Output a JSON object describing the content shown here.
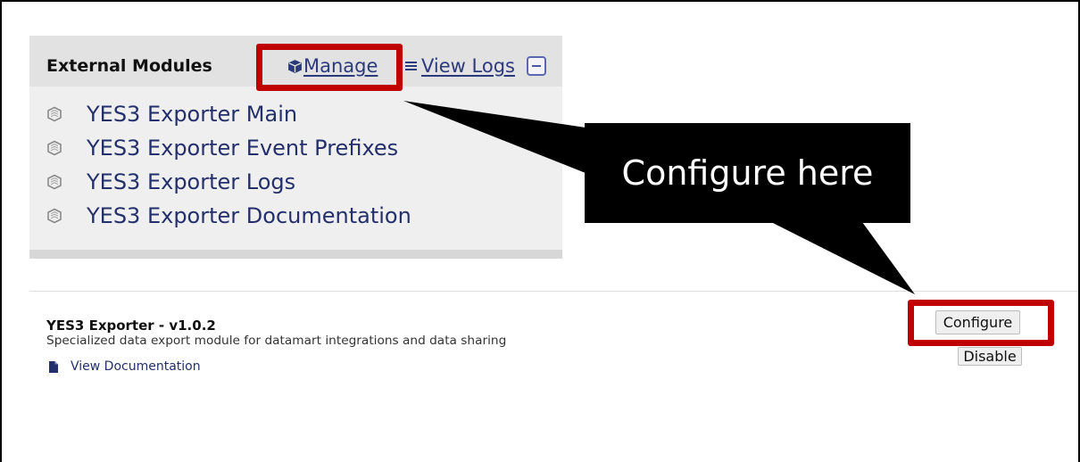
{
  "panel": {
    "title": "External Modules",
    "manage_label": "Manage",
    "manage_icon": "cube-icon",
    "view_logs_label": "View Logs",
    "view_logs_icon": "list-icon",
    "collapse_icon": "collapse-icon",
    "items": [
      {
        "label": "YES3 Exporter Main",
        "icon": "module-icon"
      },
      {
        "label": "YES3 Exporter Event Prefixes",
        "icon": "module-icon"
      },
      {
        "label": "YES3 Exporter Logs",
        "icon": "module-icon"
      },
      {
        "label": "YES3 Exporter Documentation",
        "icon": "module-icon"
      }
    ]
  },
  "callout": {
    "text": "Configure here"
  },
  "module": {
    "name": "YES3 Exporter - v1.0.2",
    "description": "Specialized data export module for datamart integrations and data sharing",
    "doc_link_label": "View Documentation",
    "doc_link_icon": "file-icon",
    "configure_label": "Configure",
    "disable_label": "Disable"
  },
  "colors": {
    "annotation_red": "#c00000",
    "callout_background": "#000000",
    "callout_text": "#ffffff",
    "link": "#2b3a7c",
    "module_link": "#23306b"
  }
}
